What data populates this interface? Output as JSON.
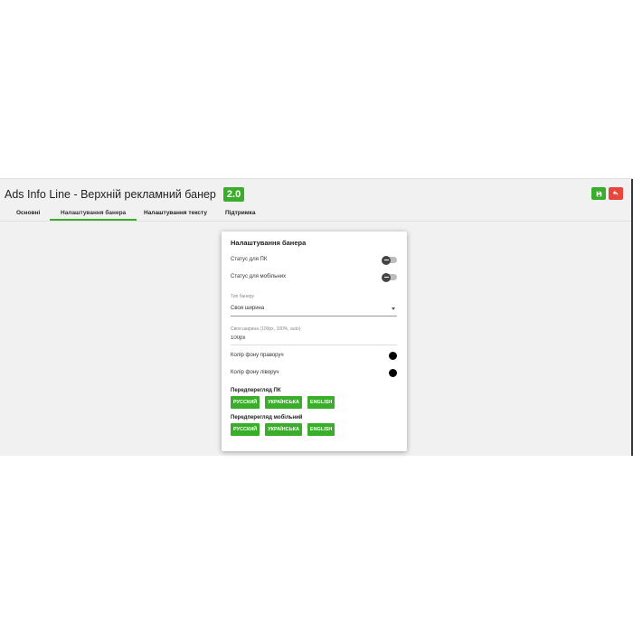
{
  "header": {
    "title": "Ads Info Line - Верхній рекламний банер",
    "version": "2.0"
  },
  "tabs": [
    {
      "label": "Основні"
    },
    {
      "label": "Налаштування банера"
    },
    {
      "label": "Налаштування тексту"
    },
    {
      "label": "Підтримка"
    }
  ],
  "active_tab": "Налаштування банера",
  "card": {
    "title": "Налаштування банера",
    "status_pc": {
      "label": "Статус для ПК",
      "enabled": false
    },
    "status_mobile": {
      "label": "Статус для мобільних",
      "enabled": false
    },
    "banner_type": {
      "label": "Тип банеру",
      "value": "Своя ширина"
    },
    "custom_width": {
      "label": "Своя ширина (100px, 100%, auto)",
      "value": "100px"
    },
    "bg_right": {
      "label": "Колір фону праворуч",
      "color": "#000000"
    },
    "bg_left": {
      "label": "Колір фону ліворуч",
      "color": "#000000"
    },
    "preview_pc": {
      "label": "Передперегляд ПК",
      "buttons": [
        "РУССКИЙ",
        "УКРАЇНСЬКА",
        "ENGLISH"
      ]
    },
    "preview_mobile": {
      "label": "Передперегляд мобільний",
      "buttons": [
        "РУССКИЙ",
        "УКРАЇНСЬКА",
        "ENGLISH"
      ]
    }
  },
  "colors": {
    "accent": "#3aae2a",
    "danger": "#e8453c"
  },
  "icons": {
    "save": "save-icon",
    "back": "undo-icon"
  }
}
